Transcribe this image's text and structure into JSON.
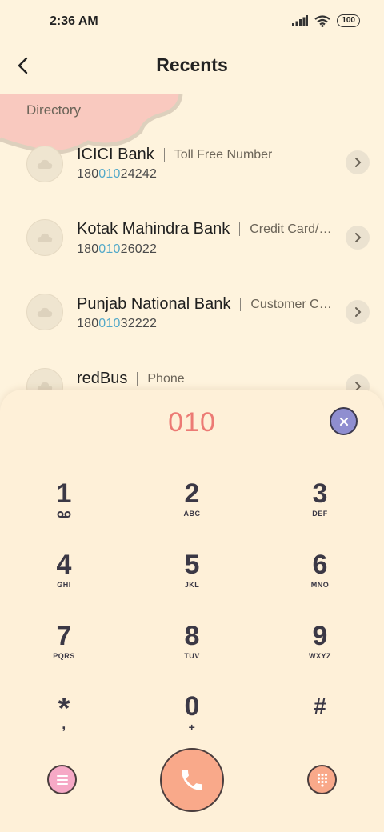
{
  "status_bar": {
    "time": "2:36 AM",
    "battery": "100"
  },
  "header": {
    "title": "Recents"
  },
  "directory": {
    "label": "Directory",
    "items": [
      {
        "name": "ICICI Bank",
        "type": "Toll Free Number",
        "number_pre": "180",
        "number_match": "010",
        "number_post": "24242"
      },
      {
        "name": "Kotak Mahindra Bank",
        "type": "Credit Card/…",
        "number_pre": "180",
        "number_match": "010",
        "number_post": "26022"
      },
      {
        "name": "Punjab National Bank",
        "type": "Customer C…",
        "number_pre": "180",
        "number_match": "010",
        "number_post": "32222"
      },
      {
        "name": "redBus",
        "type": "Phone",
        "number_pre": "",
        "number_match": "",
        "number_post": ""
      }
    ]
  },
  "dialer": {
    "display": "010",
    "keys": [
      {
        "digit": "1",
        "letters": ""
      },
      {
        "digit": "2",
        "letters": "ABC"
      },
      {
        "digit": "3",
        "letters": "DEF"
      },
      {
        "digit": "4",
        "letters": "GHI"
      },
      {
        "digit": "5",
        "letters": "JKL"
      },
      {
        "digit": "6",
        "letters": "MNO"
      },
      {
        "digit": "7",
        "letters": "PQRS"
      },
      {
        "digit": "8",
        "letters": "TUV"
      },
      {
        "digit": "9",
        "letters": "WXYZ"
      },
      {
        "digit": "*",
        "letters": ","
      },
      {
        "digit": "0",
        "letters": "+"
      },
      {
        "digit": "#",
        "letters": ""
      }
    ]
  },
  "icons": {
    "back": "back-arrow-icon",
    "clear": "close-icon",
    "call": "phone-icon",
    "menu": "menu-icon",
    "keypad": "keypad-icon",
    "voicemail": "voicemail-icon",
    "avatar": "cloud-icon",
    "chevron": "chevron-right-icon"
  },
  "colors": {
    "background": "#fef3dd",
    "dial_text": "#ec7a74",
    "match_highlight": "#53a9c9",
    "clear_button": "#8f8ed0",
    "call_button": "#f9a98a",
    "menu_button": "#f6a9c6",
    "keypad_button": "#f9a98a"
  }
}
